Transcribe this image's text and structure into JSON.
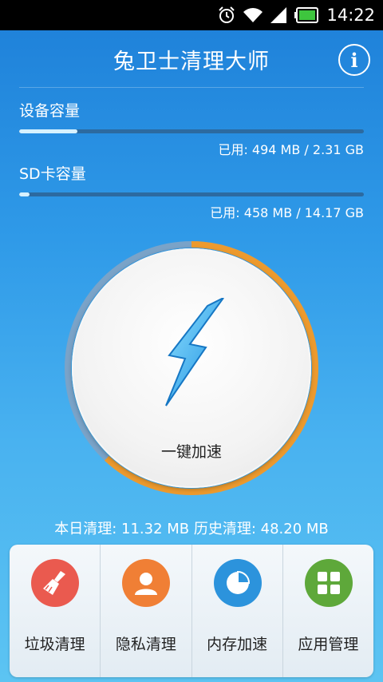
{
  "status_bar": {
    "time": "14:22",
    "icons": [
      "alarm-icon",
      "wifi-icon",
      "signal-icon",
      "battery-icon"
    ],
    "battery_color": "#3ec53e"
  },
  "header": {
    "title": "兔卫士清理大师",
    "info_icon": "i"
  },
  "storage": {
    "device": {
      "label": "设备容量",
      "usage_text": "已用: 494 MB / 2.31 GB",
      "used_fraction": 0.17
    },
    "sd_card": {
      "label": "SD卡容量",
      "usage_text": "已用: 458 MB / 14.17 GB",
      "used_fraction": 0.03
    }
  },
  "boost": {
    "label": "一键加速",
    "ring_fraction": 0.62,
    "ring_color": "#ec9a2e",
    "ring_track_color": "#7aa3c8",
    "icon": "lightning-bolt-icon"
  },
  "stats": {
    "text": "本日清理: 11.32 MB 历史清理: 48.20 MB"
  },
  "tools": [
    {
      "label": "垃圾清理",
      "icon": "broom-icon",
      "color": "#ea5a4f"
    },
    {
      "label": "隐私清理",
      "icon": "person-icon",
      "color": "#f07f35"
    },
    {
      "label": "内存加速",
      "icon": "pie-chart-icon",
      "color": "#2c93dc"
    },
    {
      "label": "应用管理",
      "icon": "grid-icon",
      "color": "#5ea83a"
    }
  ]
}
